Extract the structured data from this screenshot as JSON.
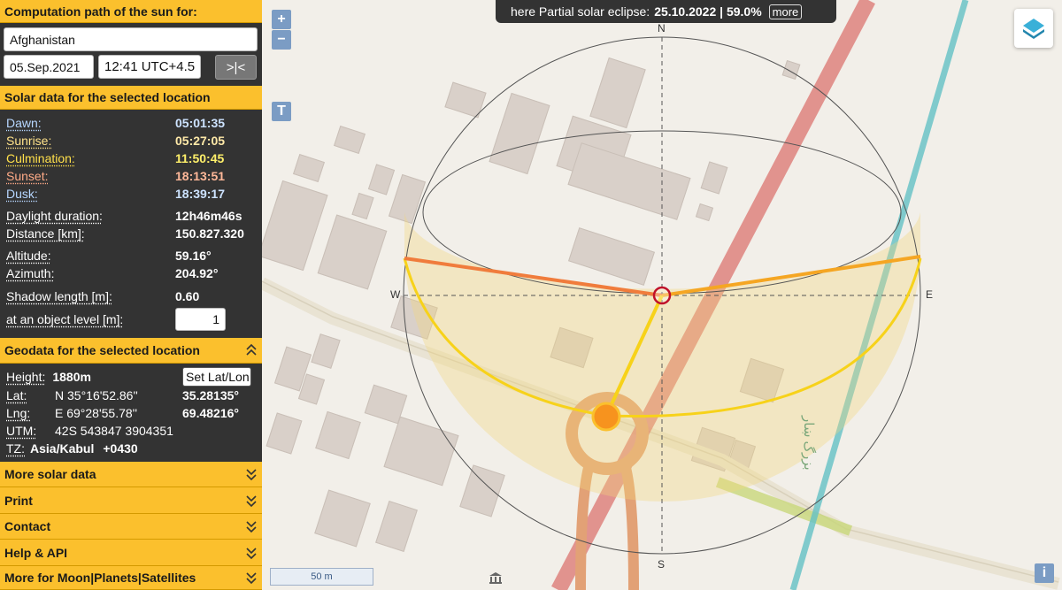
{
  "header": {
    "title": "Computation path of the sun for:",
    "location": "Afghanistan",
    "date": "05.Sep.2021",
    "time": "12:41 UTC+4.5",
    "now_button": ">|<"
  },
  "solar": {
    "title": "Solar data for the selected location",
    "dawn_label": "Dawn:",
    "dawn": "05:01:35",
    "sunrise_label": "Sunrise:",
    "sunrise": "05:27:05",
    "culmination_label": "Culmination:",
    "culmination": "11:50:45",
    "sunset_label": "Sunset:",
    "sunset": "18:13:51",
    "dusk_label": "Dusk:",
    "dusk": "18:39:17",
    "daylight_label": "Daylight duration:",
    "daylight": "12h46m46s",
    "distance_label": "Distance [km]:",
    "distance": "150.827.320",
    "altitude_label": "Altitude:",
    "altitude": "59.16°",
    "azimuth_label": "Azimuth:",
    "azimuth": "204.92°",
    "shadow_label": "Shadow length [m]:",
    "shadow": "0.60",
    "object_label": "at an object level [m]:",
    "object_level": "1"
  },
  "geo": {
    "title": "Geodata for the selected location",
    "height_label": "Height:",
    "height": "1880m",
    "setlatlon": "Set Lat/Lon",
    "lat_label": "Lat:",
    "lat_dms": "N 35°16'52.86''",
    "lat_dec": "35.28135°",
    "lng_label": "Lng:",
    "lng_dms": "E 69°28'55.78''",
    "lng_dec": "69.48216°",
    "utm_label": "UTM:",
    "utm": "42S 543847 3904351",
    "tz_label": "TZ:",
    "tz": "Asia/Kabul",
    "tz_offset": "+0430"
  },
  "menu": {
    "more_solar": "More solar data",
    "print": "Print",
    "contact": "Contact",
    "help": "Help & API",
    "moon": "More for Moon|Planets|Satellites"
  },
  "map": {
    "zoom_in": "+",
    "zoom_out": "−",
    "terrain_button": "T",
    "eclipse_text": "here Partial solar eclipse:",
    "eclipse_value": "25.10.2022 | 59.0%",
    "eclipse_more": "more",
    "scale": "50 m",
    "compass_n": "N",
    "compass_s": "S",
    "compass_e": "E",
    "compass_w": "W",
    "info": "i",
    "arabic_label": "بزرگ ښار"
  },
  "colors": {
    "accent": "#fbc02d",
    "panel": "#333333",
    "sunrise_line": "#f5a623",
    "sunset_line": "#f07c3c",
    "sun_now_line": "#f7d21a",
    "sun_marker": "#f7931e"
  }
}
